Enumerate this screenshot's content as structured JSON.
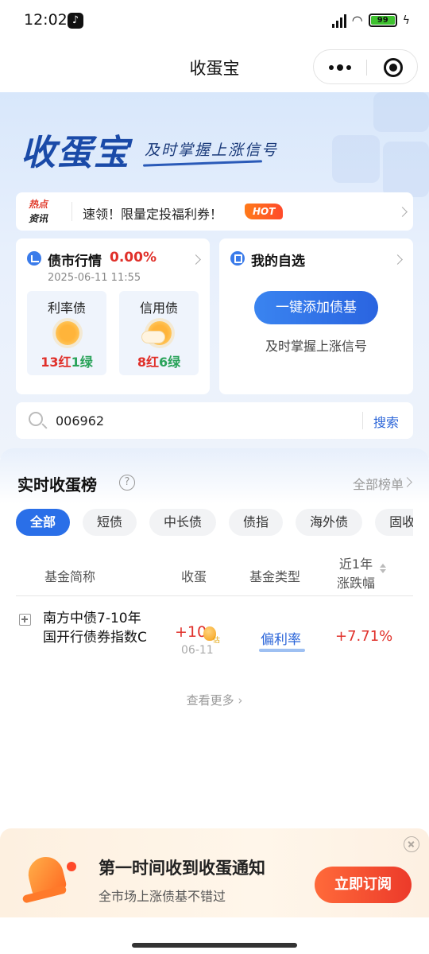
{
  "status_bar": {
    "time": "12:02",
    "battery": "99"
  },
  "app": {
    "title": "收蛋宝"
  },
  "hero": {
    "logo": "收蛋宝",
    "slogan": "及时掌握上涨信号"
  },
  "news": {
    "tag_line1": "热点",
    "tag_line2": "资讯",
    "text": "速领！限量定投福利券！",
    "badge": "HOT"
  },
  "market": {
    "title": "债市行情",
    "change": "0.00%",
    "time": "2025-06-11 11:55",
    "bonds": [
      {
        "label": "利率债",
        "red": "13红",
        "green": "1绿"
      },
      {
        "label": "信用债",
        "red": "8红",
        "green": "6绿"
      }
    ]
  },
  "watchlist": {
    "title": "我的自选",
    "button": "一键添加债基",
    "subtitle": "及时掌握上涨信号"
  },
  "search": {
    "value": "006962",
    "button": "搜索"
  },
  "rank": {
    "title": "实时收蛋榜",
    "help": "?",
    "all_label": "全部榜单",
    "tabs": [
      "全部",
      "短债",
      "中长债",
      "债指",
      "海外债",
      "固收+"
    ],
    "headers": {
      "name": "基金简称",
      "egg": "收蛋",
      "type": "基金类型",
      "return_l1": "近1年",
      "return_l2": "涨跌幅"
    },
    "rows": [
      {
        "name": "南方中债7-10年国开行债券指数C",
        "egg": "+10",
        "egg_tag": "估",
        "date": "06-11",
        "type": "偏利率",
        "return": "+7.71%"
      }
    ],
    "view_more": "查看更多"
  },
  "notify": {
    "title": "第一时间收到收蛋通知",
    "subtitle": "全市场上涨债基不错过",
    "button": "立即订阅"
  }
}
